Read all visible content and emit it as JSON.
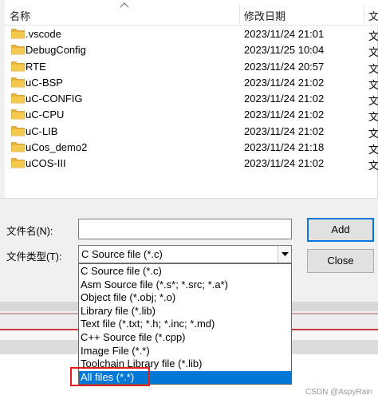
{
  "columns": {
    "name": "名称",
    "modified": "修改日期",
    "type": "文"
  },
  "files": [
    {
      "name": ".vscode",
      "date": "2023/11/24 21:01",
      "type": "文"
    },
    {
      "name": "DebugConfig",
      "date": "2023/11/25 10:04",
      "type": "文"
    },
    {
      "name": "RTE",
      "date": "2023/11/24 20:57",
      "type": "文"
    },
    {
      "name": "uC-BSP",
      "date": "2023/11/24 21:02",
      "type": "文"
    },
    {
      "name": "uC-CONFIG",
      "date": "2023/11/24 21:02",
      "type": "文"
    },
    {
      "name": "uC-CPU",
      "date": "2023/11/24 21:02",
      "type": "文"
    },
    {
      "name": "uC-LIB",
      "date": "2023/11/24 21:02",
      "type": "文"
    },
    {
      "name": "uCos_demo2",
      "date": "2023/11/24 21:18",
      "type": "文"
    },
    {
      "name": "uCOS-III",
      "date": "2023/11/24 21:02",
      "type": "文"
    }
  ],
  "form": {
    "filename_label": "文件名(N):",
    "filename_value": "",
    "filetype_label": "文件类型(T):",
    "filetype_value": "C Source file (*.c)"
  },
  "buttons": {
    "add": "Add",
    "close": "Close"
  },
  "filetype_options": [
    "C Source file (*.c)",
    "Asm Source file (*.s*; *.src; *.a*)",
    "Object file (*.obj; *.o)",
    "Library file (*.lib)",
    "Text file (*.txt; *.h; *.inc; *.md)",
    "C++ Source file (*.cpp)",
    "Image File (*.*)",
    "Toolchain Library file (*.lib)",
    "All files (*.*)"
  ],
  "selected_option_index": 8,
  "colors": {
    "selection": "#0078d7",
    "highlight_box": "#e02020",
    "folder": "#e8b43c"
  },
  "watermark": "CSDN @AspyRain"
}
